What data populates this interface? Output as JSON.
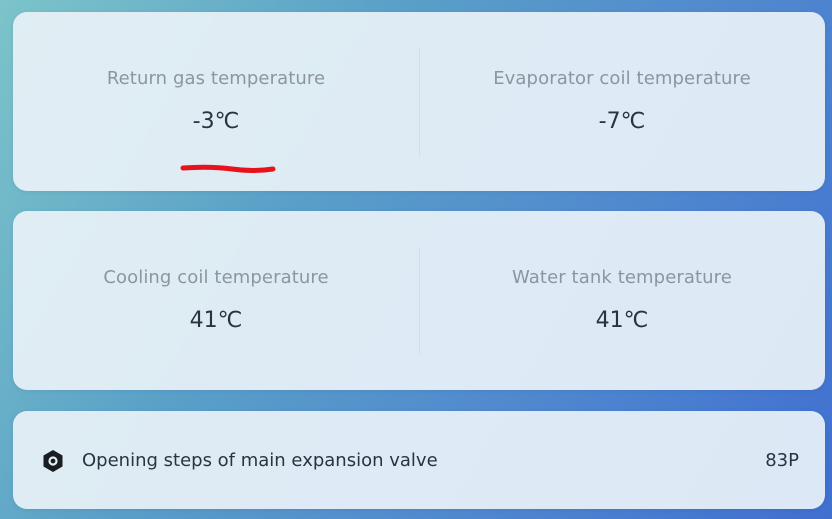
{
  "temperatures_top": {
    "left": {
      "label": "Return gas temperature",
      "value": "-3℃"
    },
    "right": {
      "label": "Evaporator coil temperature",
      "value": "-7℃"
    }
  },
  "temperatures_bottom": {
    "left": {
      "label": "Cooling coil temperature",
      "value": "41℃"
    },
    "right": {
      "label": "Water tank temperature",
      "value": "41℃"
    }
  },
  "valve": {
    "icon": "hex-nut-icon",
    "label": "Opening steps of main expansion valve",
    "value": "83P"
  },
  "colors": {
    "annotation": "#e8121c",
    "card_background": "#e8f1f8",
    "label_text": "#8d959e",
    "value_text": "#2b3340"
  }
}
